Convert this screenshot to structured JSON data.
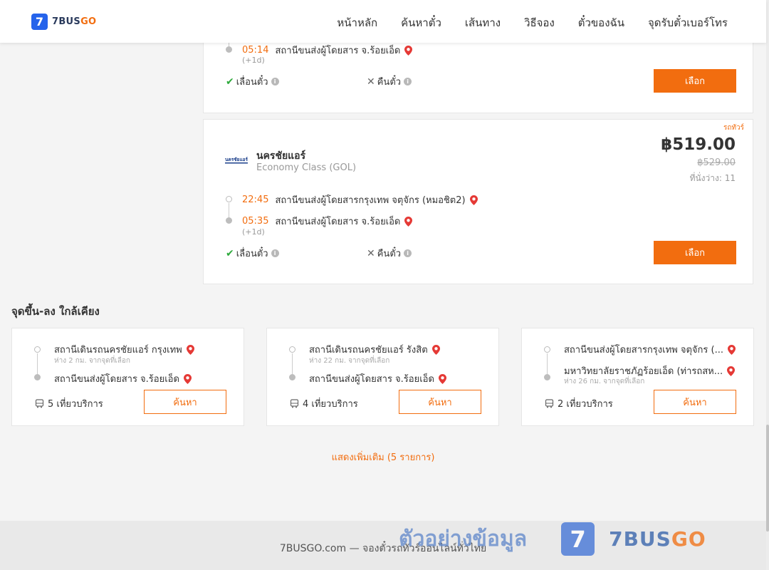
{
  "brand": {
    "logo_mark": "7",
    "name_a": "7BUS",
    "name_b": "GO"
  },
  "nav": [
    "หน้าหลัก",
    "ค้นหาตั๋ว",
    "เส้นทาง",
    "วิธีจอง",
    "ตั๋วของฉัน",
    "จุดรับตั๋วเบอร์โทร"
  ],
  "card1": {
    "arrive_time": "05:14",
    "arrive_station": "สถานีขนส่งผู้โดยสาร จ.ร้อยเอ็ด",
    "next_day": "(+1d)",
    "reschedule": "เลื่อนตั๋ว",
    "refund": "คืนตั๋ว",
    "select": "เลือก"
  },
  "card2": {
    "tag": "รถทัวร์",
    "operator_logo_text": "นครชัยแอร์",
    "operator": "นครชัยแอร์",
    "class": "Economy Class (GOL)",
    "price": "฿519.00",
    "old_price": "฿529.00",
    "seats": "ที่นั่งว่าง: 11",
    "depart_time": "22:45",
    "depart_station": "สถานีขนส่งผู้โดยสารกรุงเทพ จตุจักร (หมอชิต2)",
    "arrive_time": "05:35",
    "arrive_station": "สถานีขนส่งผู้โดยสาร จ.ร้อยเอ็ด",
    "next_day": "(+1d)",
    "reschedule": "เลื่อนตั๋ว",
    "refund": "คืนตั๋ว",
    "select": "เลือก"
  },
  "nearby": {
    "title": "จุดขึ้น-ลง ใกล้เคียง",
    "items": [
      {
        "from": "สถานีเดินรถนครชัยแอร์ กรุงเทพ",
        "from_dist": "ห่าง 2 กม. จากจุดที่เลือก",
        "to": "สถานีขนส่งผู้โดยสาร จ.ร้อยเอ็ด",
        "to_dist": "",
        "trips": "5 เที่ยวบริการ",
        "search": "ค้นหา"
      },
      {
        "from": "สถานีเดินรถนครชัยแอร์ รังสิต",
        "from_dist": "ห่าง 22 กม. จากจุดที่เลือก",
        "to": "สถานีขนส่งผู้โดยสาร จ.ร้อยเอ็ด",
        "to_dist": "",
        "trips": "4 เที่ยวบริการ",
        "search": "ค้นหา"
      },
      {
        "from": "สถานีขนส่งผู้โดยสารกรุงเทพ จตุจักร (...",
        "from_dist": "",
        "to": "มหาวิทยาลัยราชภัฏร้อยเอ็ด (ท่ารถสห...",
        "to_dist": "ห่าง 26 กม. จากจุดที่เลือก",
        "trips": "2 เที่ยวบริการ",
        "search": "ค้นหา"
      }
    ],
    "show_more": "แสดงเพิ่มเติม (5 รายการ)"
  },
  "footer": {
    "text": "7BUSGO.com — จองตั๋วรถทัวร์ออนไลน์ทั่วไทย",
    "watermark_text": "ตัวอย่างข้อมูล",
    "watermark_mark": "7",
    "watermark_brand_a": "7BUS",
    "watermark_brand_b": "GO"
  },
  "colors": {
    "accent": "#f26d0f",
    "brand_blue": "#2563eb",
    "ok_green": "#2eaa3c",
    "pin_red": "#e53935"
  }
}
